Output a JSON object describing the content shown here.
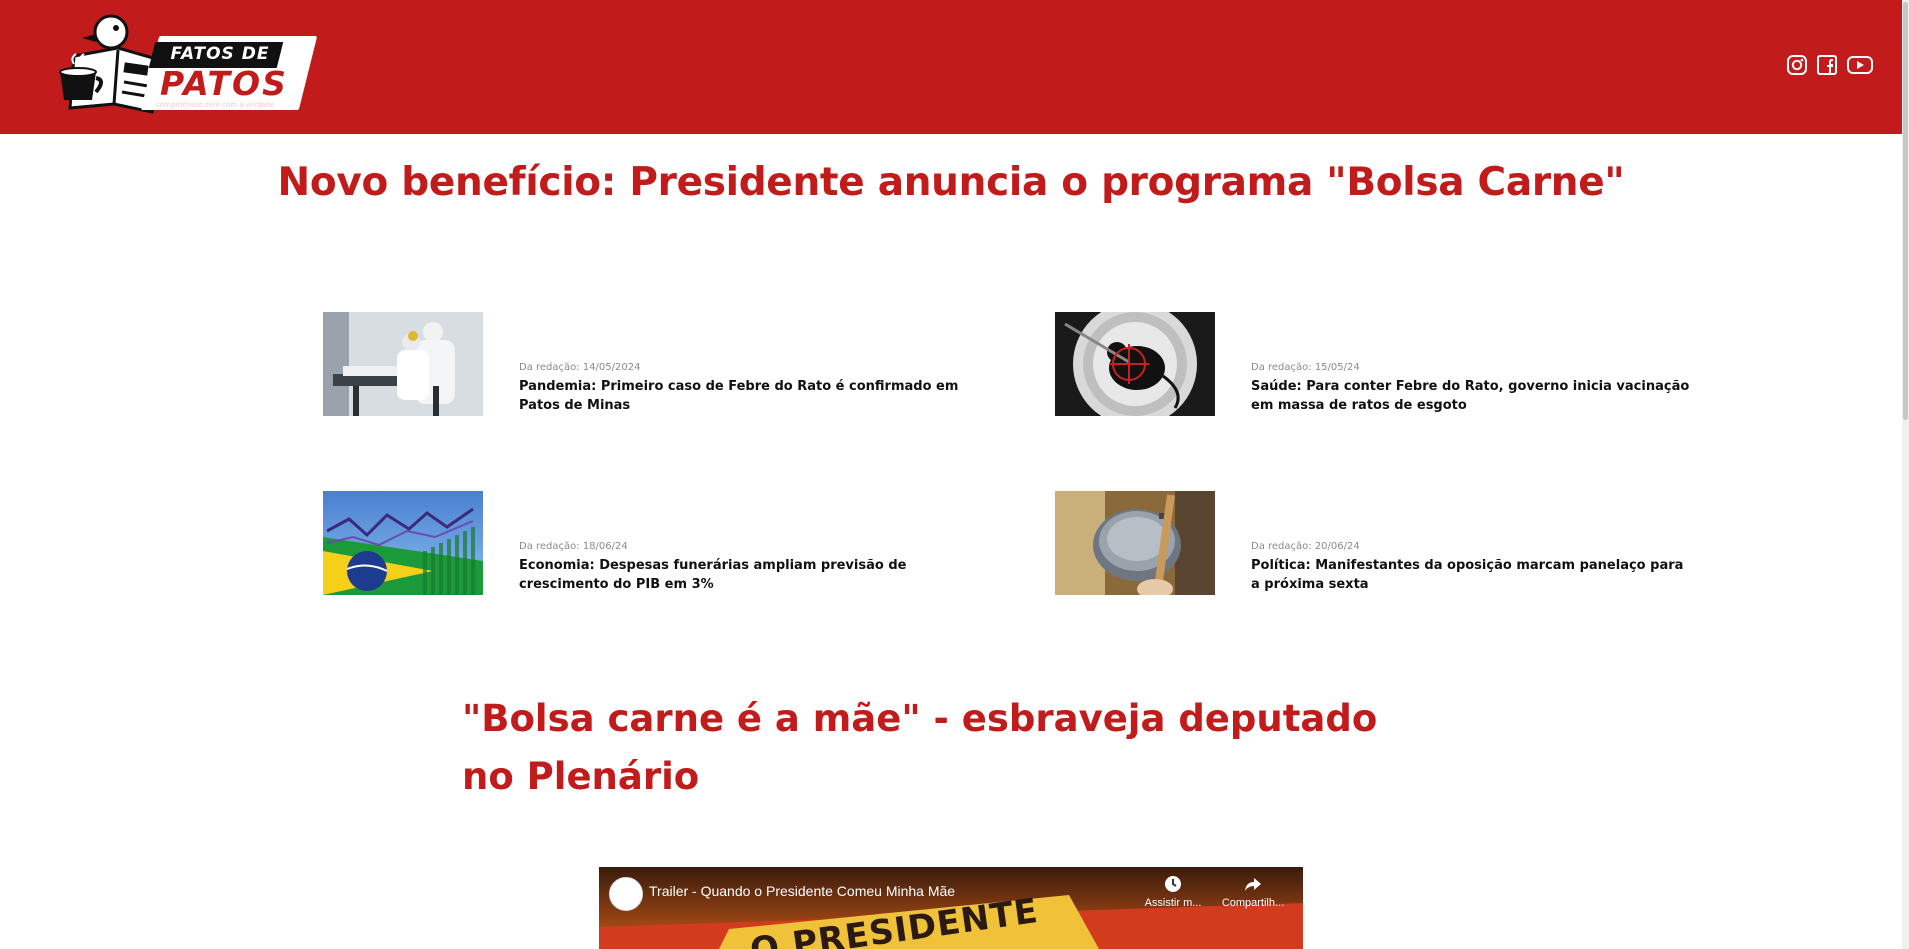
{
  "brand": {
    "name_top": "FATOS DE",
    "name_main": "PATOS",
    "slogan": "compromisso zero com a verdade"
  },
  "colors": {
    "brand_red": "#c21b1b",
    "text_dark": "#111111",
    "date_gray": "#8a8a8a"
  },
  "social": [
    {
      "name": "instagram-icon"
    },
    {
      "name": "facebook-icon"
    },
    {
      "name": "youtube-icon"
    }
  ],
  "headline": "Novo benefício: Presidente anuncia o programa \"Bolsa Carne\"",
  "news": [
    {
      "date": "Da redação: 14/05/2024",
      "title": "Pandemia: Primeiro caso de Febre do Rato é confirmado em Patos de Minas"
    },
    {
      "date": "Da redação: 15/05/24",
      "title": "Saúde: Para conter Febre do Rato, governo inicia vacinação em massa de ratos de esgoto"
    },
    {
      "date": "Da redação: 18/06/24",
      "title": "Economia: Despesas funerárias ampliam previsão de crescimento do PIB em 3%"
    },
    {
      "date": "Da redação: 20/06/24",
      "title": "Política: Manifestantes da oposição marcam panelaço para a próxima sexta"
    }
  ],
  "headline2": "\"Bolsa carne é a mãe\" - esbraveja deputado no Plenário",
  "video": {
    "title": "Trailer - Quando o Presidente Comeu Minha Mãe",
    "watch_label": "Assistir m...",
    "share_label": "Compartilh...",
    "poster_text": "O PRESIDENTE"
  }
}
